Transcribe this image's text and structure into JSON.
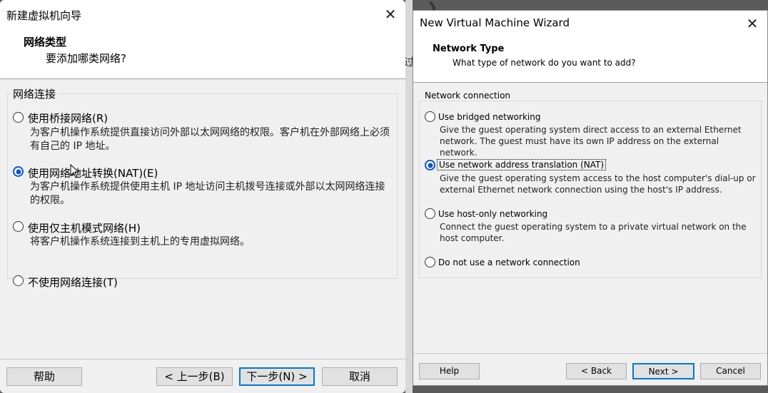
{
  "background": {
    "hint": "过",
    "chevron": "❯"
  },
  "cn": {
    "window_title": "新建虚拟机向导",
    "header_title": "网络类型",
    "header_subtitle": "要添加哪类网络?",
    "group_label": "网络连接",
    "options": [
      {
        "label": "使用桥接网络(R)",
        "desc": "为客户机操作系统提供直接访问外部以太网网络的权限。客户机在外部网络上必须有自己的 IP 地址。",
        "checked": false
      },
      {
        "label": "使用网络地址转换(NAT)(E)",
        "desc": "为客户机操作系统提供使用主机 IP 地址访问主机拨号连接或外部以太网网络连接的权限。",
        "checked": true
      },
      {
        "label": "使用仅主机模式网络(H)",
        "desc": "将客户机操作系统连接到主机上的专用虚拟网络。",
        "checked": false
      },
      {
        "label": "不使用网络连接(T)",
        "desc": "",
        "checked": false
      }
    ],
    "buttons": {
      "help": "帮助",
      "back": "< 上一步(B)",
      "next": "下一步(N) >",
      "cancel": "取消"
    }
  },
  "en": {
    "window_title": "New Virtual Machine Wizard",
    "header_title": "Network Type",
    "header_subtitle": "What type of network do you want to add?",
    "group_label": "Network connection",
    "options": [
      {
        "label": "Use bridged networking",
        "desc": "Give the guest operating system direct access to an external Ethernet network. The guest must have its own IP address on the external network.",
        "checked": false
      },
      {
        "label": "Use network address translation (NAT)",
        "desc": "Give the guest operating system access to the host computer's dial-up or external Ethernet network connection using the host's IP address.",
        "checked": true
      },
      {
        "label": "Use host-only networking",
        "desc": "Connect the guest operating system to a private virtual network on the host computer.",
        "checked": false
      },
      {
        "label": "Do not use a network connection",
        "desc": "",
        "checked": false
      }
    ],
    "buttons": {
      "help": "Help",
      "back": "< Back",
      "next": "Next >",
      "cancel": "Cancel"
    }
  },
  "colors": {
    "accent": "#0078d7",
    "radio_checked": "#0a58ca",
    "dialog_bg": "#f0f0f0"
  }
}
